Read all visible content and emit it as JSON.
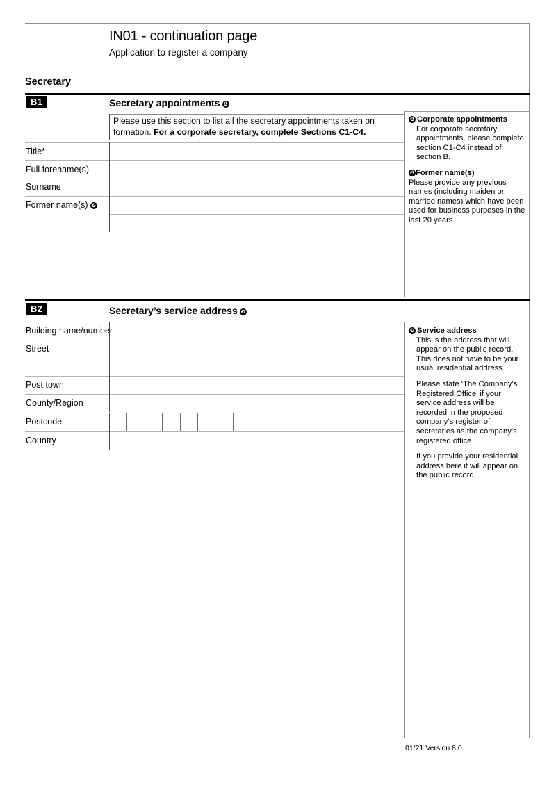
{
  "document": {
    "title": "IN01 - continuation page",
    "subtitle": "Application to register a company",
    "group_heading": "Secretary",
    "footer": "01/21 Version 8.0"
  },
  "sections": {
    "b1": {
      "badge": "B1",
      "heading": "Secretary appointments",
      "marker": "❶",
      "instruction_line1": "Please use this section to list all the secretary appointments taken on formation.",
      "instruction_line2": "For a corporate secretary, complete Sections C1-C4.",
      "fields": [
        {
          "label": "Title*",
          "value": ""
        },
        {
          "label": "Full forename(s)",
          "value": ""
        },
        {
          "label": "Surname",
          "value": ""
        },
        {
          "label": "Former name(s)",
          "value": "",
          "marker": "❷"
        },
        {
          "label": "",
          "value": ""
        }
      ],
      "guidance": [
        {
          "marker": "❶",
          "title": "Corporate appointments",
          "body": "For corporate secretary appointments, please complete section C1-C4 instead of section B."
        },
        {
          "marker": "❷",
          "title": "Former name(s)",
          "body": "Please provide any previous names (including maiden or married names) which have been used for business purposes in the last 20 years."
        }
      ]
    },
    "b2": {
      "badge": "B2",
      "heading": "Secretary’s service address",
      "marker": "❸",
      "fields": [
        {
          "label": "Building name/number",
          "value": ""
        },
        {
          "label": "Street",
          "value": ""
        },
        {
          "label": "",
          "value": ""
        },
        {
          "label": "Post town",
          "value": ""
        },
        {
          "label": "County/Region",
          "value": ""
        },
        {
          "label": "Postcode",
          "value": "",
          "type": "postcode",
          "boxes": 8
        },
        {
          "label": "Country",
          "value": ""
        }
      ],
      "guidance": [
        {
          "marker": "❸",
          "title": "Service address",
          "body": "This is the address that will appear on the public record. This does not have to be your usual residential address.",
          "para2": "Please state ‘The Company’s Registered Office’ if your service address will be recorded in the proposed company’s register of secretaries as the company’s registered office.",
          "para3": "If you provide your residential address here it will appear on the public record."
        }
      ]
    }
  }
}
